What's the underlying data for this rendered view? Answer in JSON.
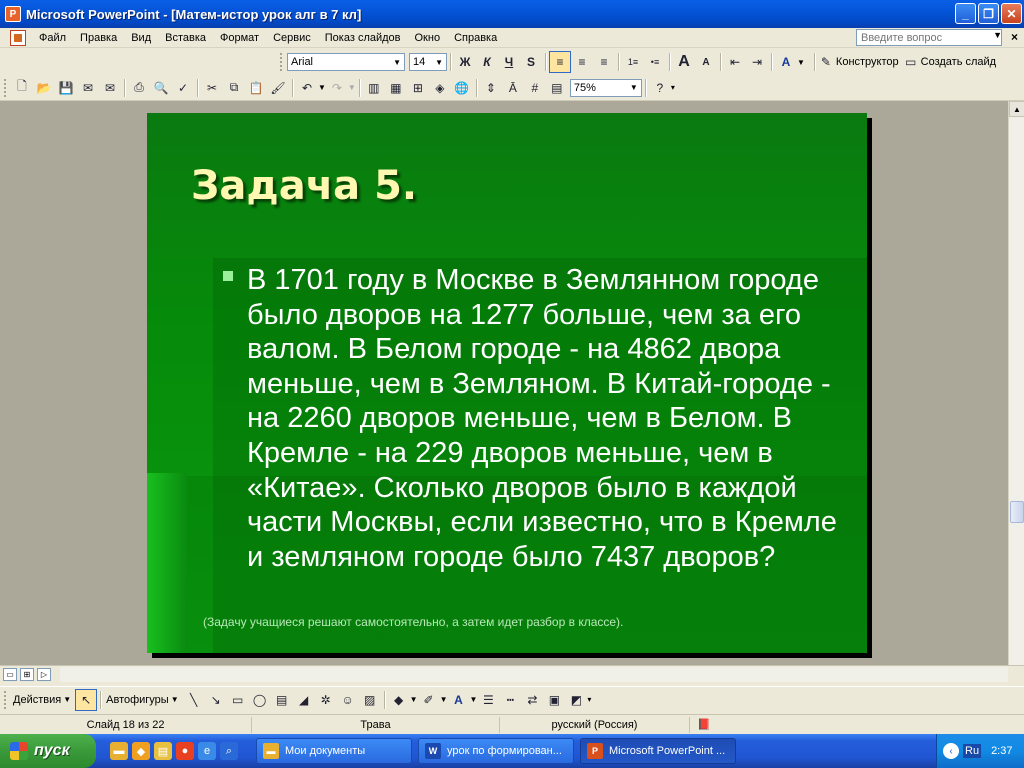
{
  "window": {
    "title": "Microsoft PowerPoint - [Матем-истор урок алг в 7 кл]",
    "app_icon": "P"
  },
  "menu": {
    "items": [
      "Файл",
      "Правка",
      "Вид",
      "Вставка",
      "Формат",
      "Сервис",
      "Показ слайдов",
      "Окно",
      "Справка"
    ],
    "help_placeholder": "Введите вопрос"
  },
  "format_toolbar": {
    "font": "Arial",
    "size": "14",
    "bold": "Ж",
    "italic": "К",
    "underline": "Ч",
    "shadow": "S",
    "designer": "Конструктор",
    "new_slide": "Создать слайд"
  },
  "standard_toolbar": {
    "zoom": "75%"
  },
  "slide": {
    "title": "Задача 5.",
    "body": "В 1701 году в Москве в Землянном городе было дворов на 1277 больше, чем за его валом. В Белом городе - на 4862 двора меньше, чем в Земляном. В Китай-городе - на 2260 дворов меньше, чем в Белом. В Кремле - на 229 дворов меньше, чем в «Китае». Сколько дворов было в каждой части Москвы, если известно, что в Кремле и земляном городе было 7437 дворов?",
    "note": "(Задачу учащиеся решают самостоятельно, а затем идет разбор в классе)."
  },
  "drawing_toolbar": {
    "actions": "Действия",
    "autoshapes": "Автофигуры"
  },
  "status": {
    "slide": "Слайд 18 из 22",
    "design": "Трава",
    "language": "русский (Россия)"
  },
  "taskbar": {
    "start": "пуск",
    "tasks": [
      "Мои документы",
      "урок по формирован...",
      "Microsoft PowerPoint ..."
    ],
    "lang": "Ru",
    "clock": "2:37"
  }
}
